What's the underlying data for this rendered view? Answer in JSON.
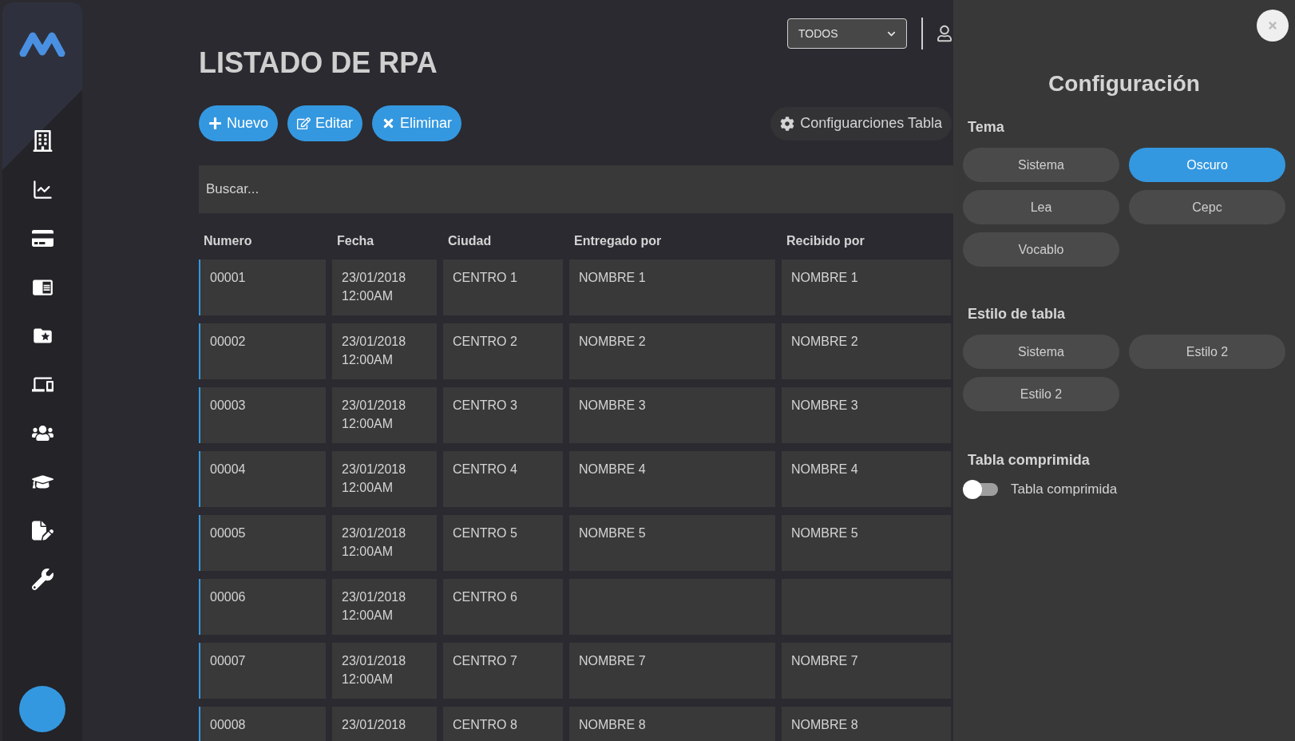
{
  "top_bar": {
    "filter_select": {
      "value": "TODOS"
    }
  },
  "title": "LISTADO DE RPA",
  "actions": [
    {
      "kind": "new",
      "label": "Nuevo"
    },
    {
      "kind": "edit",
      "label": "Editar"
    },
    {
      "kind": "delete",
      "label": "Eliminar"
    }
  ],
  "table_settings_button": "Configuarciones Tabla",
  "search": {
    "placeholder": "Buscar..."
  },
  "table": {
    "columns": [
      "Numero",
      "Fecha",
      "Ciudad",
      "Entregado por",
      "Recibido por"
    ],
    "rows": [
      {
        "numero": "00001",
        "fecha": [
          "23/01/2018",
          "12:00AM"
        ],
        "ciudad": "CENTRO 1",
        "entregado": "NOMBRE 1",
        "recibido": "NOMBRE 1"
      },
      {
        "numero": "00002",
        "fecha": [
          "23/01/2018",
          "12:00AM"
        ],
        "ciudad": "CENTRO 2",
        "entregado": "NOMBRE 2",
        "recibido": "NOMBRE 2"
      },
      {
        "numero": "00003",
        "fecha": [
          "23/01/2018",
          "12:00AM"
        ],
        "ciudad": "CENTRO 3",
        "entregado": "NOMBRE 3",
        "recibido": "NOMBRE 3"
      },
      {
        "numero": "00004",
        "fecha": [
          "23/01/2018",
          "12:00AM"
        ],
        "ciudad": "CENTRO 4",
        "entregado": "NOMBRE 4",
        "recibido": "NOMBRE 4"
      },
      {
        "numero": "00005",
        "fecha": [
          "23/01/2018",
          "12:00AM"
        ],
        "ciudad": "CENTRO 5",
        "entregado": "NOMBRE 5",
        "recibido": "NOMBRE 5"
      },
      {
        "numero": "00006",
        "fecha": [
          "23/01/2018",
          "12:00AM"
        ],
        "ciudad": "CENTRO 6",
        "entregado": null,
        "recibido": null
      },
      {
        "numero": "00007",
        "fecha": [
          "23/01/2018",
          "12:00AM"
        ],
        "ciudad": "CENTRO 7",
        "entregado": "NOMBRE 7",
        "recibido": "NOMBRE 7"
      },
      {
        "numero": "00008",
        "fecha": [
          "23/01/2018"
        ],
        "ciudad": "CENTRO 8",
        "entregado": "NOMBRE 8",
        "recibido": "NOMBRE 8"
      }
    ]
  },
  "settings_panel": {
    "title": "Configuración",
    "theme": {
      "label": "Tema",
      "options": [
        {
          "label": "Sistema",
          "selected": false
        },
        {
          "label": "Oscuro",
          "selected": true
        },
        {
          "label": "Lea",
          "selected": false
        },
        {
          "label": "Cepc",
          "selected": false
        },
        {
          "label": "Vocablo",
          "selected": false
        }
      ]
    },
    "table_style": {
      "label": "Estilo de tabla",
      "options": [
        {
          "label": "Sistema",
          "selected": false
        },
        {
          "label": "Estilo 2",
          "selected": false
        },
        {
          "label": "Estilo 2",
          "selected": false
        }
      ]
    },
    "compressed": {
      "label": "Tabla comprimida",
      "toggle_label": "Tabla comprimida",
      "on": false
    }
  }
}
